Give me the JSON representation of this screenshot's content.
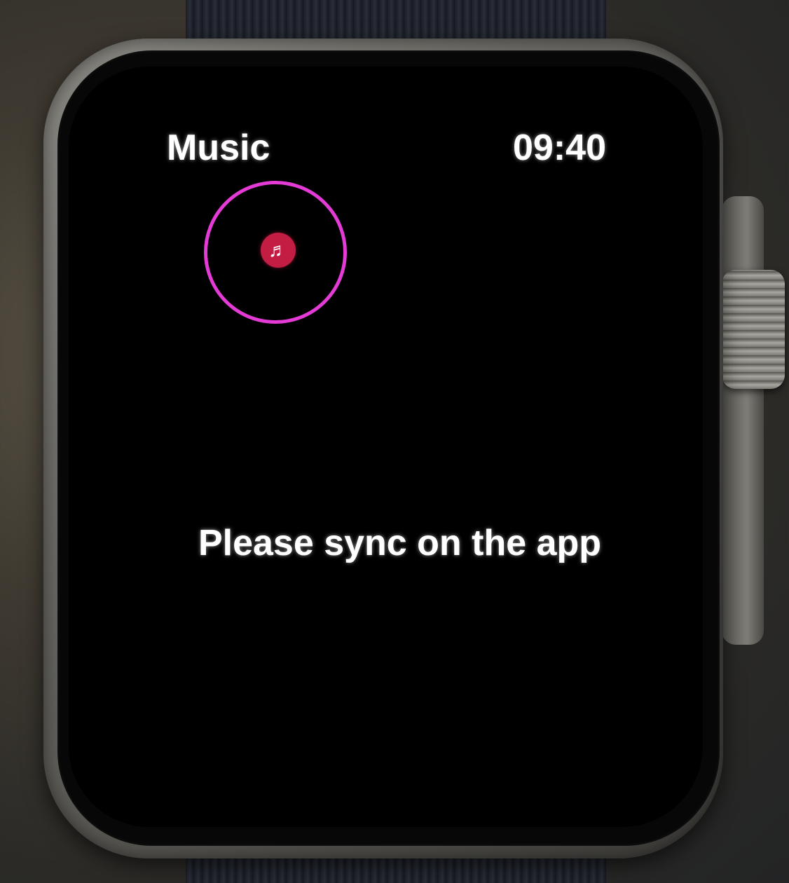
{
  "header": {
    "title": "Music",
    "time": "09:40"
  },
  "music_icon": {
    "icon": "music-note-icon",
    "glyph": "♬",
    "color": "#c41d44"
  },
  "highlight": {
    "color": "#e53bd6"
  },
  "main": {
    "message": "Please sync on the app"
  }
}
